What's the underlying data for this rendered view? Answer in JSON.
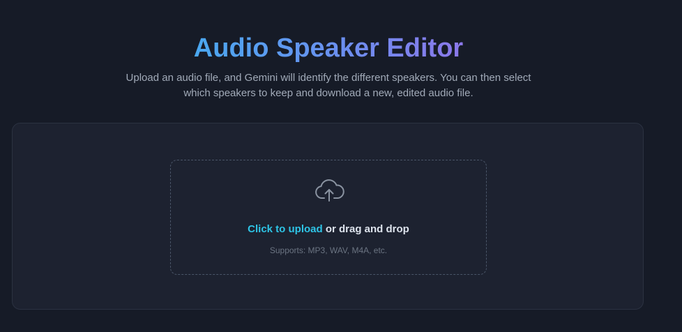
{
  "header": {
    "title": "Audio Speaker Editor",
    "description_line1": "Upload an audio file, and Gemini will identify the different speakers. You can then select",
    "description_line2": "which speakers to keep and download a new, edited audio file."
  },
  "upload": {
    "icon": "cloud-upload-icon",
    "link_label": "Click to upload",
    "rest_label": " or drag and drop",
    "supports_text": "Supports: MP3, WAV, M4A, etc."
  },
  "colors": {
    "background": "#161b27",
    "card": "#1d2230",
    "accent_link": "#2ec4e6",
    "title_gradient_start": "#4aa8f0",
    "title_gradient_end": "#8b78ea"
  }
}
